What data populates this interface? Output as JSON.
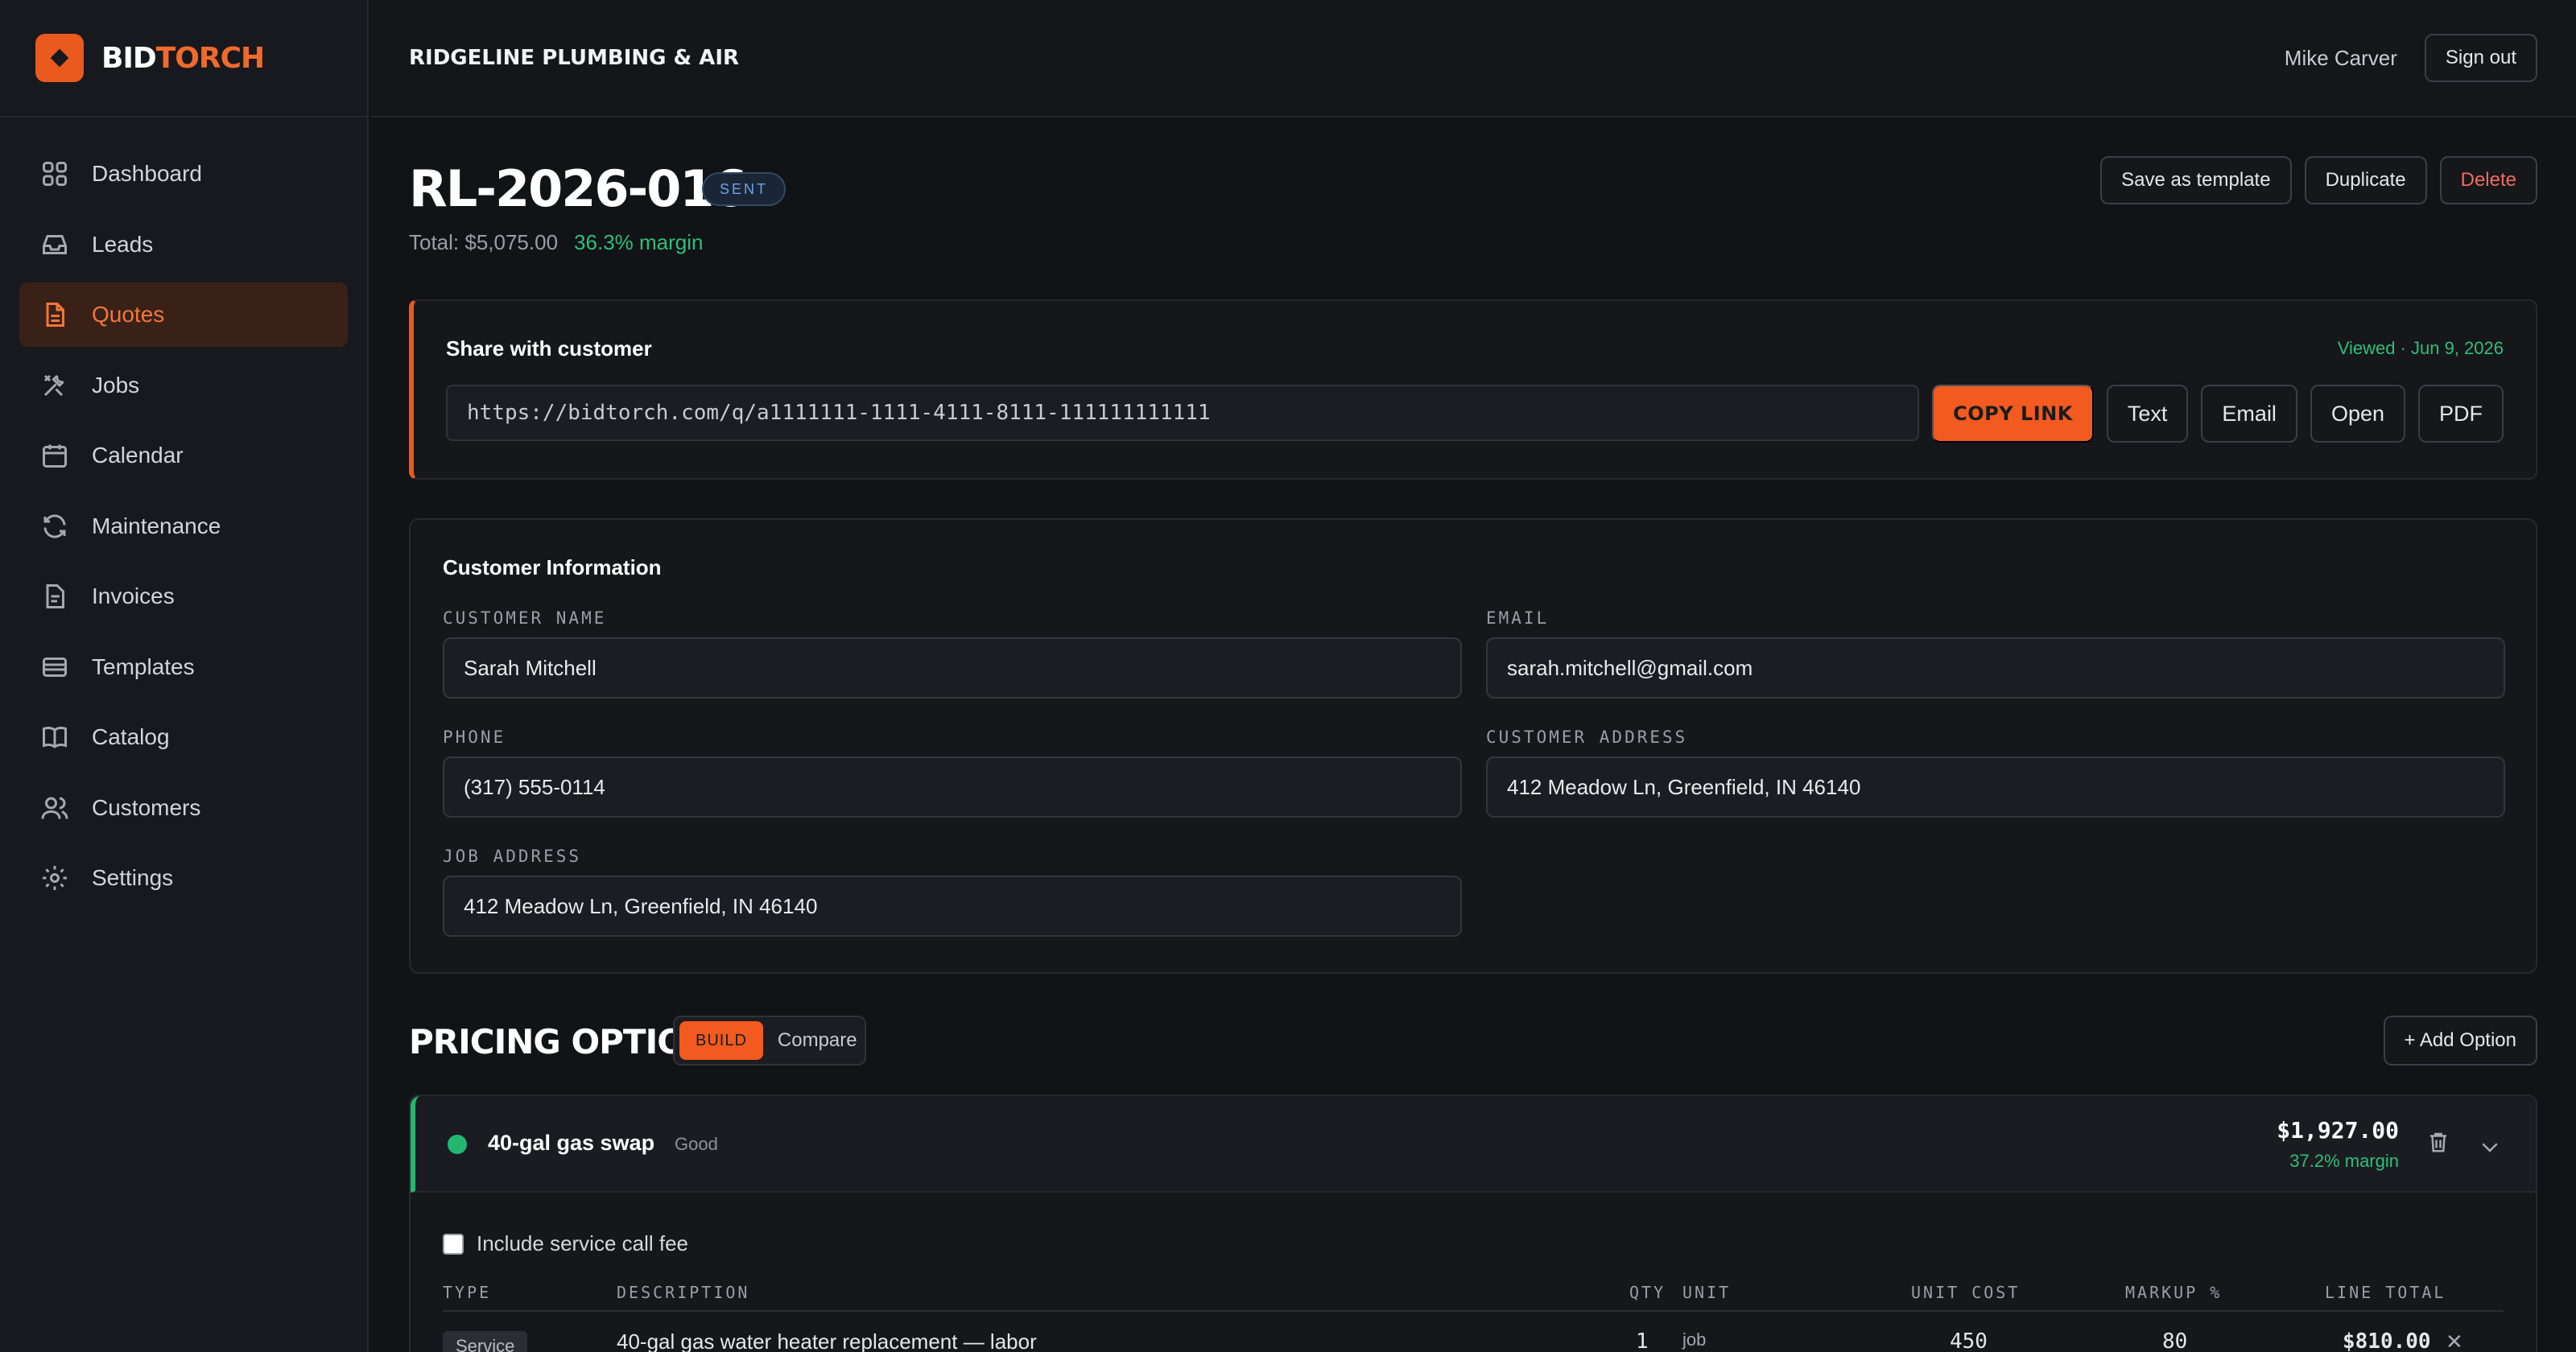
{
  "brand": {
    "part1": "BID",
    "part2": "TORCH"
  },
  "nav": [
    {
      "label": "Dashboard",
      "icon": "dashboard-icon"
    },
    {
      "label": "Leads",
      "icon": "inbox-icon"
    },
    {
      "label": "Quotes",
      "icon": "document-icon",
      "active": true
    },
    {
      "label": "Jobs",
      "icon": "tools-icon"
    },
    {
      "label": "Calendar",
      "icon": "calendar-icon"
    },
    {
      "label": "Maintenance",
      "icon": "refresh-icon"
    },
    {
      "label": "Invoices",
      "icon": "invoice-icon"
    },
    {
      "label": "Templates",
      "icon": "card-icon"
    },
    {
      "label": "Catalog",
      "icon": "book-icon"
    },
    {
      "label": "Customers",
      "icon": "users-icon"
    },
    {
      "label": "Settings",
      "icon": "gear-icon"
    }
  ],
  "topbar": {
    "company": "RIDGELINE PLUMBING & AIR",
    "user": "Mike Carver",
    "signout": "Sign out"
  },
  "quote": {
    "id": "RL-2026-016",
    "status": "SENT",
    "total": "Total: $5,075.00",
    "margin": "36.3% margin",
    "actions": {
      "save_template": "Save as template",
      "duplicate": "Duplicate",
      "delete": "Delete"
    }
  },
  "share": {
    "title": "Share with customer",
    "viewed": "Viewed · Jun 9, 2026",
    "url": "https://bidtorch.com/q/a1111111-1111-4111-8111-111111111111",
    "copy": "COPY LINK",
    "text": "Text",
    "email": "Email",
    "open": "Open",
    "pdf": "PDF"
  },
  "customer": {
    "title": "Customer Information",
    "name_label": "CUSTOMER NAME",
    "name": "Sarah Mitchell",
    "email_label": "EMAIL",
    "email": "sarah.mitchell@gmail.com",
    "phone_label": "PHONE",
    "phone": "(317) 555-0114",
    "address_label": "CUSTOMER ADDRESS",
    "address": "412 Meadow Ln, Greenfield, IN 46140",
    "job_label": "JOB ADDRESS",
    "job_address": "412 Meadow Ln, Greenfield, IN 46140"
  },
  "pricing": {
    "title": "PRICING OPTIONS",
    "build": "BUILD",
    "compare": "Compare",
    "add_option": "+ Add Option",
    "option": {
      "name": "40-gal gas swap",
      "tier": "Good",
      "price": "$1,927.00",
      "margin": "37.2% margin",
      "service_fee": "Include service call fee",
      "columns": [
        "TYPE",
        "DESCRIPTION",
        "QTY",
        "UNIT",
        "UNIT COST",
        "MARKUP %",
        "LINE TOTAL"
      ],
      "row": {
        "type": "Service",
        "description": "40-gal gas water heater replacement — labor",
        "qty": "1",
        "unit": "job",
        "unit_cost": "450",
        "markup": "80",
        "line_total": "$810.00"
      }
    }
  },
  "colors": {
    "accent": "#f25a1f",
    "good": "#22b872",
    "bg": "#111317"
  }
}
